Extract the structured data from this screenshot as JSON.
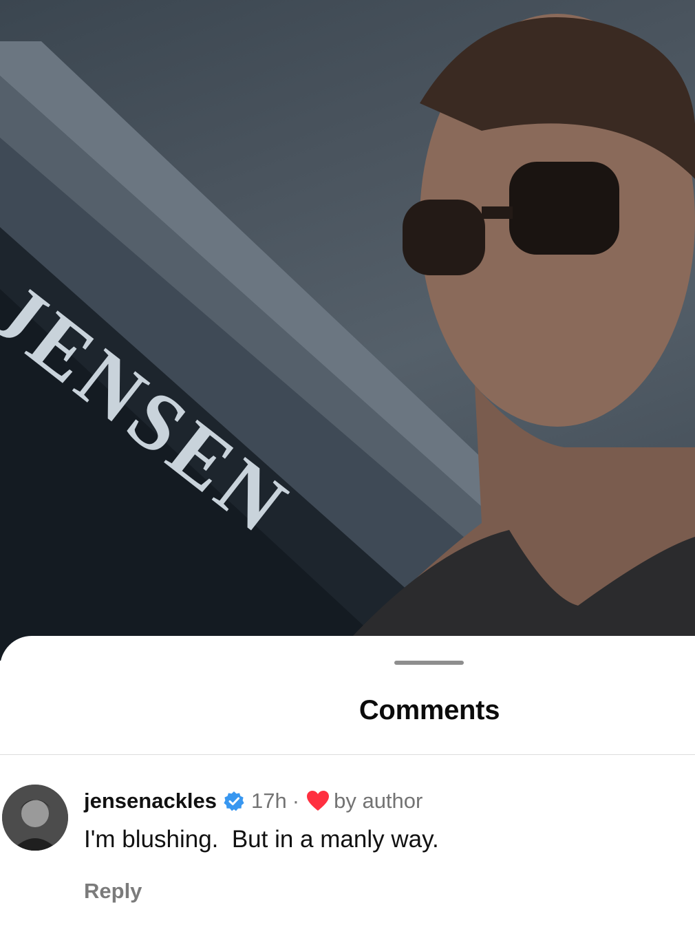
{
  "photo": {
    "sign_text": "JENSEN"
  },
  "sheet": {
    "title": "Comments"
  },
  "comment": {
    "username": "jensenackles",
    "time": "17h",
    "separator": "·",
    "liked_by": "by author",
    "text": "I'm blushing.  But in a manly way.",
    "reply_label": "Reply"
  },
  "colors": {
    "verified": "#3897f0",
    "heart": "#ff3040",
    "meta_gray": "#737373"
  }
}
